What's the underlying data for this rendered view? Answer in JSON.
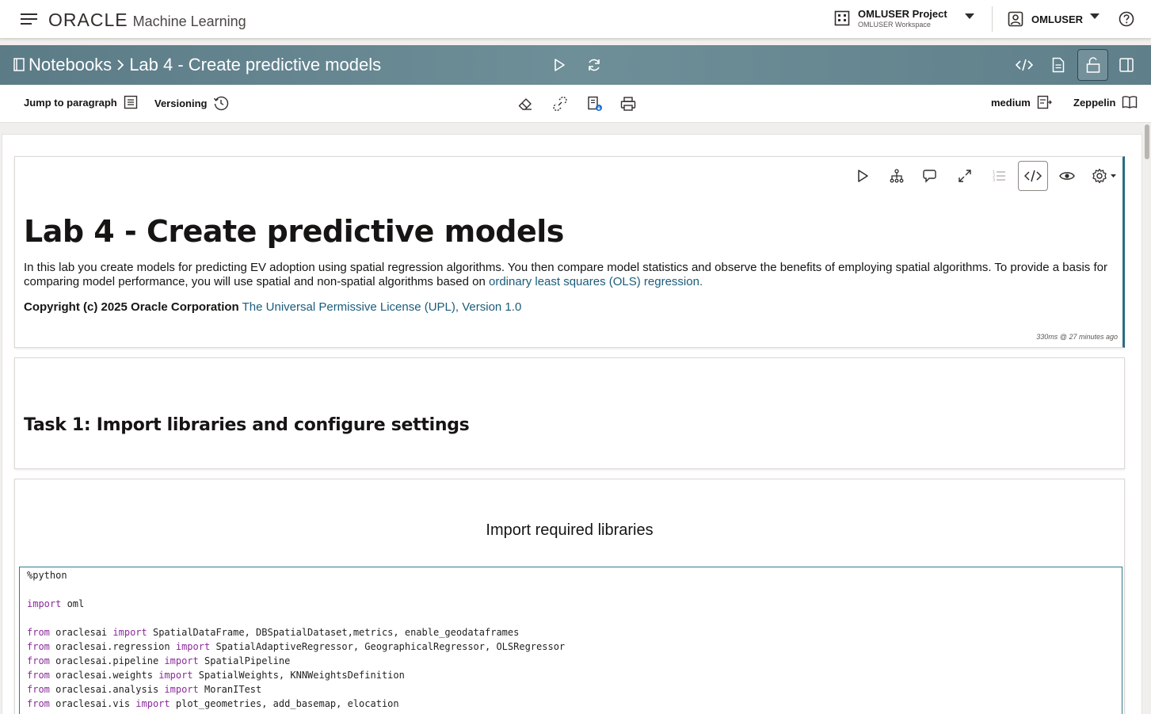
{
  "header": {
    "brand_oracle": "ORACLE",
    "brand_product": "Machine Learning",
    "project_name": "OMLUSER Project",
    "workspace_name": "OMLUSER Workspace",
    "user_name": "OMLUSER"
  },
  "notebook_band": {
    "breadcrumb_root": "Notebooks",
    "breadcrumb_separator": ">",
    "notebook_title": "Lab 4 - Create predictive models"
  },
  "toolbar": {
    "jump_to_paragraph": "Jump to paragraph",
    "versioning": "Versioning",
    "size_label": "medium",
    "interpreter_label": "Zeppelin"
  },
  "paragraphs": {
    "intro": {
      "heading": "Lab 4 - Create predictive models",
      "description": "In this lab you create models for predicting EV adoption using spatial regression algorithms. You then compare model statistics and observe the benefits of employing spatial algorithms. To provide a basis for comparing model performance, you will use spatial and non-spatial algorithms based on ",
      "description_link": "ordinary least squares (OLS) regression.",
      "copyright": "Copyright (c) 2025 Oracle Corporation",
      "license_link": "The Universal Permissive License (UPL), Version 1.0",
      "run_info": "330ms @ 27 minutes ago"
    },
    "task1": {
      "heading": "Task 1: Import libraries and configure settings"
    },
    "imports": {
      "heading": "Import required libraries",
      "code": [
        [
          {
            "t": "%python"
          }
        ],
        [
          {
            "t": ""
          }
        ],
        [
          {
            "t": "import",
            "k": true
          },
          {
            "t": " oml"
          }
        ],
        [
          {
            "t": ""
          }
        ],
        [
          {
            "t": "from",
            "k": true
          },
          {
            "t": " oraclesai "
          },
          {
            "t": "import",
            "k": true
          },
          {
            "t": " SpatialDataFrame, DBSpatialDataset,metrics, enable_geodataframes"
          }
        ],
        [
          {
            "t": "from",
            "k": true
          },
          {
            "t": " oraclesai.regression "
          },
          {
            "t": "import",
            "k": true
          },
          {
            "t": " SpatialAdaptiveRegressor, GeographicalRegressor, OLSRegressor"
          }
        ],
        [
          {
            "t": "from",
            "k": true
          },
          {
            "t": " oraclesai.pipeline "
          },
          {
            "t": "import",
            "k": true
          },
          {
            "t": " SpatialPipeline"
          }
        ],
        [
          {
            "t": "from",
            "k": true
          },
          {
            "t": " oraclesai.weights "
          },
          {
            "t": "import",
            "k": true
          },
          {
            "t": " SpatialWeights, KNNWeightsDefinition"
          }
        ],
        [
          {
            "t": "from",
            "k": true
          },
          {
            "t": " oraclesai.analysis "
          },
          {
            "t": "import",
            "k": true
          },
          {
            "t": " MoranITest"
          }
        ],
        [
          {
            "t": "from",
            "k": true
          },
          {
            "t": " oraclesai.vis "
          },
          {
            "t": "import",
            "k": true
          },
          {
            "t": " plot_geometries, add_basemap, elocation"
          }
        ]
      ]
    }
  },
  "colors": {
    "band": "#5f7f8a",
    "link": "#1a5c7a",
    "keyword": "#8a2b9a",
    "editor_border": "#2c7a8c"
  }
}
